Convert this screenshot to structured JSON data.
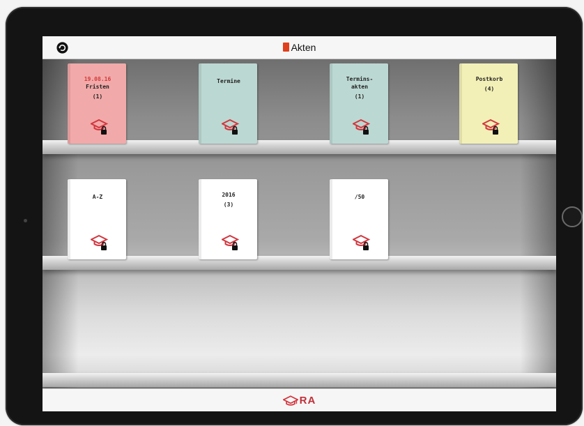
{
  "header": {
    "title": "Akten",
    "refresh_icon": "refresh-icon",
    "title_icon": "red-book-icon"
  },
  "shelves": [
    {
      "books": [
        {
          "id": "fristen",
          "date": "19.08.16",
          "lines": [
            "Fristen",
            "(1)"
          ],
          "color": "#f2a9a9"
        },
        {
          "id": "termine",
          "date": "",
          "lines": [
            "Termine"
          ],
          "color": "#bcd8d2"
        },
        {
          "id": "terminsakten",
          "date": "",
          "lines": [
            "Termins-",
            "akten",
            "(1)"
          ],
          "color": "#bcd8d2"
        },
        {
          "id": "postkorb",
          "date": "",
          "lines": [
            "Postkorb",
            "(4)"
          ],
          "color": "#f3f0b7"
        }
      ]
    },
    {
      "books": [
        {
          "id": "a-z",
          "date": "",
          "lines": [
            "A-Z"
          ],
          "color": "#ffffff"
        },
        {
          "id": "2016",
          "date": "",
          "lines": [
            "2016",
            "(3)"
          ],
          "color": "#ffffff"
        },
        {
          "id": "50",
          "date": "",
          "lines": [
            "/50"
          ],
          "color": "#ffffff"
        }
      ]
    }
  ],
  "footer": {
    "label": "RA",
    "icon": "graduation-cap-logo-icon"
  },
  "colors": {
    "accent": "#d2373f",
    "date": "#d23b3b"
  }
}
